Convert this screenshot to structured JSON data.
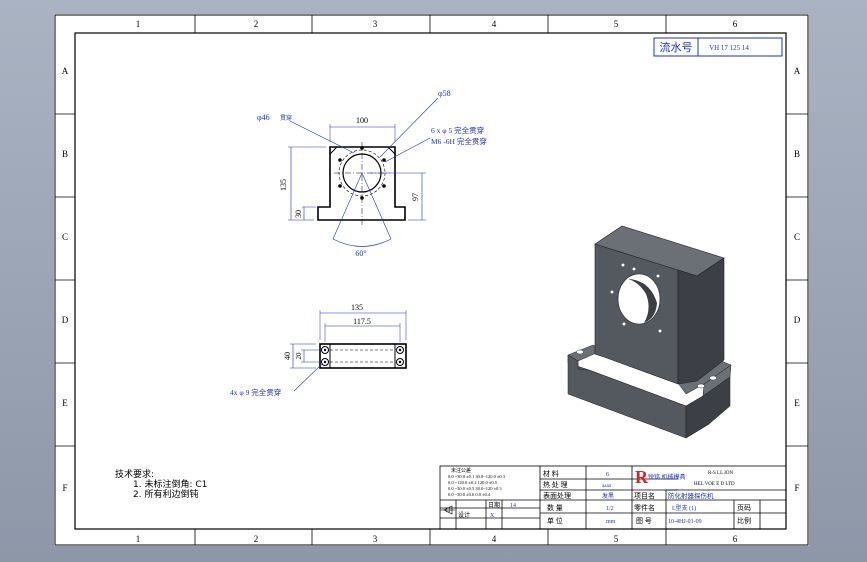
{
  "sheet": {
    "zone_columns": [
      "1",
      "2",
      "3",
      "4",
      "5",
      "6"
    ],
    "zone_rows": [
      "A",
      "B",
      "C",
      "D",
      "E",
      "F"
    ]
  },
  "header_box": {
    "label": "流水号",
    "value": "VH 17 125 14"
  },
  "front_view": {
    "dims": {
      "d46": "φ46",
      "d46_note": "贯穿",
      "d58": "φ58",
      "w100": "100",
      "holes1": "6 x φ 5 完全贯穿",
      "holes2": "M6 -6H 完全贯穿",
      "h135": "135",
      "h30": "30",
      "h97": "97",
      "angle": "60°"
    }
  },
  "top_view": {
    "dims": {
      "w135": "135",
      "w117": "117.5",
      "h40": "40",
      "h20": "20",
      "holes": "4x φ 9 完全贯穿"
    }
  },
  "notes": {
    "title": "技术要求:",
    "line1": "1. 未标注倒角: C1",
    "line2": "2. 所有利边倒钝"
  },
  "title_block": {
    "material_label": "材 料",
    "material_value": "6",
    "heat_label": "热 处 理",
    "heat_value": "aaaa",
    "surface_label": "表面处理",
    "surface_value": "发黑",
    "project_label": "项目名",
    "project_value": "防化射器探伤机",
    "qty_label": "数 量",
    "qty_value": "1/2",
    "part_label": "零件名",
    "part_value": "L型支 (1)",
    "unit_label": "单 位",
    "unit_value": "mm",
    "drawing_label": "图 号",
    "drawing_value": "10-4HJ-01-09",
    "page_label": "页码",
    "page_value": "",
    "date_label": "日期",
    "date_value": "14",
    "drafter_label": "设计",
    "drafter_value": "X",
    "scale_label": "比例",
    "company_short": "R",
    "company_cn": "锐铭 机械模具",
    "company_en1": "R-S LL ION",
    "company_en2": "HEL VOE E D  LTD",
    "tol1": "0.0 ~30.0 ±0.1   30.0~120.0 ±0.3",
    "tol2": "0.0 ~120.0 ±0.2   120.0 ±0.5",
    "tol3": "0.0 ~30.0 ±0.5   30.0~120 ±0.3",
    "tol4": "0.0 ~30.0 ±0.6   0.0 ±0.4",
    "tol_heading": "未注公差"
  },
  "colors": {
    "dimension_blue": "#1c2fc2",
    "part_fill": "#54585f",
    "part_top": "#6b6f76",
    "part_dark": "#3c3f45"
  }
}
